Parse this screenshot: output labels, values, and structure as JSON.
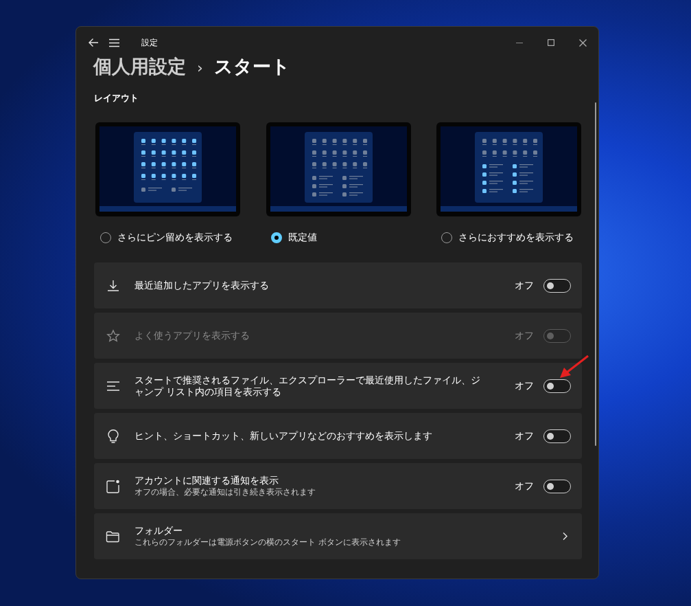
{
  "window": {
    "title": "設定"
  },
  "breadcrumb": {
    "parent": "個人用設定",
    "separator": "›",
    "current": "スタート"
  },
  "section_title": "レイアウト",
  "layout_options": [
    {
      "kind": "more_pins",
      "label": "さらにピン留めを表示する",
      "selected": false
    },
    {
      "kind": "default",
      "label": "既定値",
      "selected": true
    },
    {
      "kind": "more_recommendations",
      "label": "さらにおすすめを表示する",
      "selected": false
    }
  ],
  "settings": [
    {
      "kind": "toggle",
      "title": "最近追加したアプリを表示する",
      "state_text": "オフ",
      "on": false,
      "disabled": false
    },
    {
      "kind": "toggle",
      "title": "よく使うアプリを表示する",
      "state_text": "オフ",
      "on": false,
      "disabled": true
    },
    {
      "kind": "toggle",
      "title": "スタートで推奨されるファイル、エクスプローラーで最近使用したファイル、ジャンプ リスト内の項目を表示する",
      "state_text": "オフ",
      "on": false,
      "disabled": false
    },
    {
      "kind": "toggle",
      "title": "ヒント、ショートカット、新しいアプリなどのおすすめを表示します",
      "state_text": "オフ",
      "on": false,
      "disabled": false
    },
    {
      "kind": "toggle",
      "title": "アカウントに関連する通知を表示",
      "subtitle": "オフの場合、必要な通知は引き続き表示されます",
      "state_text": "オフ",
      "on": false,
      "disabled": false
    },
    {
      "kind": "link",
      "title": "フォルダー",
      "subtitle": "これらのフォルダーは電源ボタンの横のスタート ボタンに表示されます"
    }
  ]
}
